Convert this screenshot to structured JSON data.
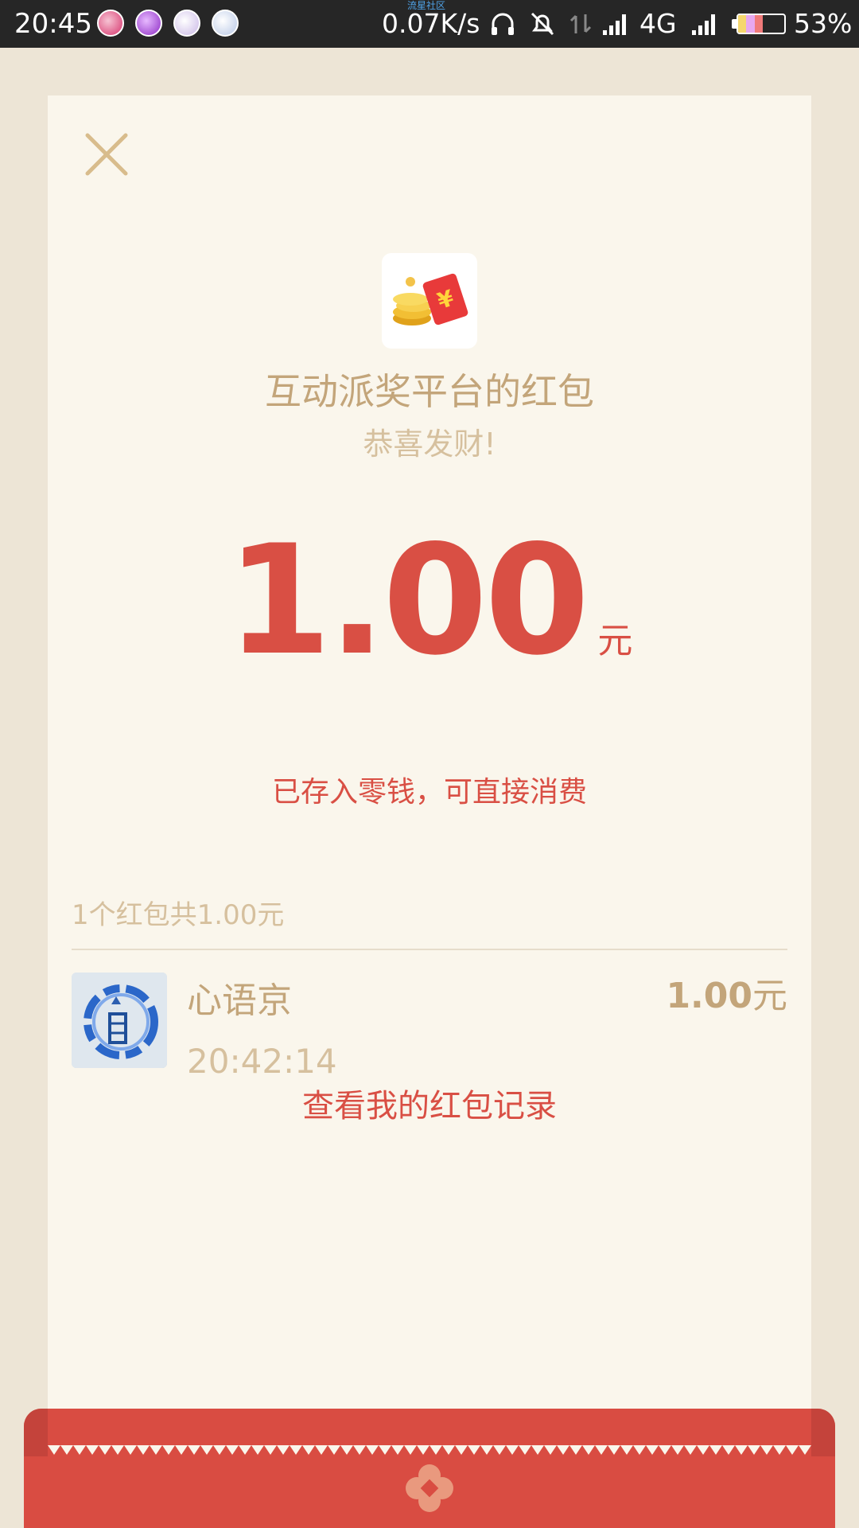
{
  "status_bar": {
    "time": "20:45",
    "caption": "流星社区",
    "net_speed": "0.07K/s",
    "network": "4G",
    "battery_percent": "53%",
    "battery_level": 0.53,
    "icons": [
      "headphones-icon",
      "mute-icon",
      "data-arrows-icon",
      "signal-icon",
      "signal-icon"
    ]
  },
  "card": {
    "close_icon": "close-icon",
    "sender_title": "互动派奖平台的红包",
    "greeting": "恭喜发财!",
    "amount": "1.00",
    "amount_unit": "元",
    "stored_note": "已存入零钱，可直接消费",
    "summary": "1个红包共1.00元",
    "record": {
      "name": "心语京",
      "time": "20:42:14",
      "amount": "1.00",
      "unit": "元"
    },
    "view_records": "查看我的红包记录"
  },
  "colors": {
    "accent_red": "#d94f44",
    "gold_text": "#c3a57a",
    "light_gold_text": "#d6c09e",
    "card_bg": "#faf6ec",
    "page_bg": "#ede5d6"
  }
}
